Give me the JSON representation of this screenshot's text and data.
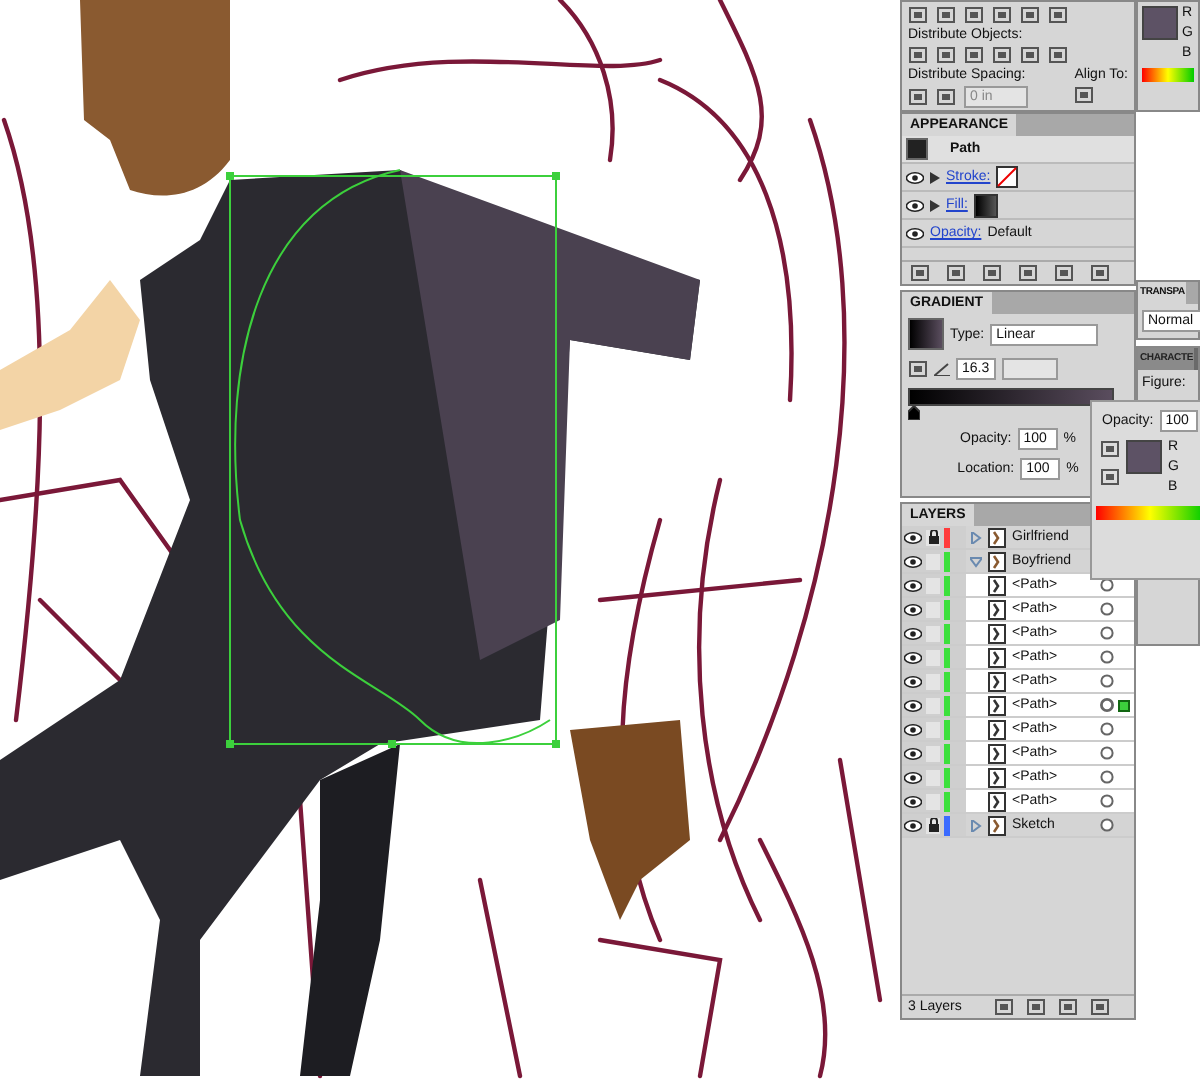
{
  "align_panel": {
    "distribute_objects_label": "Distribute Objects:",
    "distribute_spacing_label": "Distribute Spacing:",
    "spacing_value": "0 in",
    "align_to_label": "Align To:"
  },
  "color_panel": {
    "channels": [
      "R",
      "G",
      "B"
    ]
  },
  "appearance_panel": {
    "tab": "APPEARANCE",
    "object": "Path",
    "rows": [
      {
        "kind": "stroke",
        "label": "Stroke:"
      },
      {
        "kind": "fill",
        "label": "Fill:"
      },
      {
        "kind": "opacity",
        "label": "Opacity:",
        "value": "Default"
      }
    ]
  },
  "gradient_panel": {
    "tab": "GRADIENT",
    "type_label": "Type:",
    "type_value": "Linear",
    "angle": "16.3",
    "opacity_label": "Opacity:",
    "opacity_value": "100",
    "opacity_unit": "%",
    "location_label": "Location:",
    "location_value": "100",
    "location_unit": "%"
  },
  "transparency_panel": {
    "tab": "TRANSPA",
    "blend_mode": "Normal"
  },
  "character_panel": {
    "tab": "CHARACTE",
    "font_label": "Figure:"
  },
  "swatch_popup": {
    "opacity_label": "Opacity:",
    "opacity_value": "100",
    "channels": [
      "R",
      "G",
      "B"
    ]
  },
  "layers_panel": {
    "tab": "LAYERS",
    "footer": "3 Layers",
    "layers": [
      {
        "name": "Girlfriend",
        "color": "#ff3b3b",
        "locked": true,
        "expanded": false
      },
      {
        "name": "Boyfriend",
        "color": "#3be03b",
        "locked": false,
        "expanded": true,
        "children": [
          {
            "name": "<Path>",
            "selected": false
          },
          {
            "name": "<Path>",
            "selected": false
          },
          {
            "name": "<Path>",
            "selected": false
          },
          {
            "name": "<Path>",
            "selected": false
          },
          {
            "name": "<Path>",
            "selected": false
          },
          {
            "name": "<Path>",
            "selected": true
          },
          {
            "name": "<Path>",
            "selected": false
          },
          {
            "name": "<Path>",
            "selected": false
          },
          {
            "name": "<Path>",
            "selected": false
          },
          {
            "name": "<Path>",
            "selected": false
          }
        ]
      },
      {
        "name": "Sketch",
        "color": "#3b6bff",
        "locked": true,
        "expanded": false
      }
    ]
  }
}
